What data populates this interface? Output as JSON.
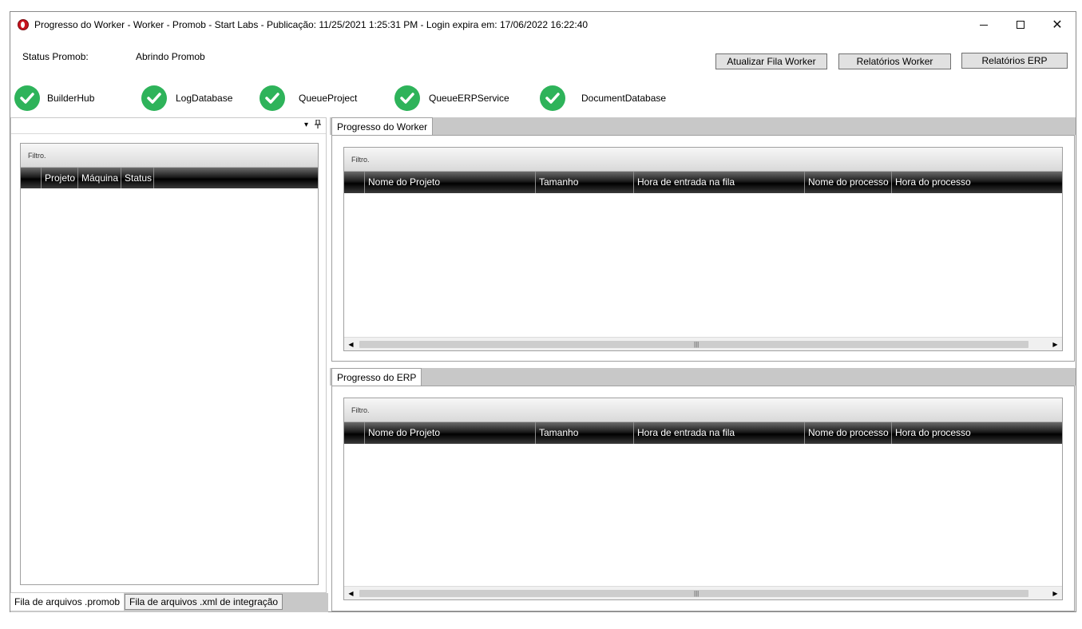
{
  "window": {
    "title": "Progresso do Worker  -  Worker - Promob  -  Start Labs  -  Publicação: 11/25/2021 1:25:31 PM - Login expira em: 17/06/2022 16:22:40",
    "controls": {
      "minimize": "minimize",
      "maximize": "maximize",
      "close": "✕"
    }
  },
  "status": {
    "label": "Status Promob:",
    "value": "Abrindo Promob"
  },
  "toolbar": {
    "update_queue": "Atualizar Fila Worker",
    "worker_reports": "Relatórios Worker",
    "erp_reports": "Relatórios ERP"
  },
  "services": [
    {
      "name": "BuilderHub",
      "status_icon": "check-icon"
    },
    {
      "name": "LogDatabase",
      "status_icon": "check-icon"
    },
    {
      "name": "QueueProject",
      "status_icon": "check-icon"
    },
    {
      "name": "QueueERPService",
      "status_icon": "check-icon"
    },
    {
      "name": "DocumentDatabase",
      "status_icon": "check-icon"
    }
  ],
  "left_panel": {
    "filter": "Filtro.",
    "columns": [
      "Projeto",
      "Máquina",
      "Status"
    ],
    "dropdown_icon": "▾",
    "pin_icon": "📌",
    "tabs": [
      "Fila de arquivos .promob",
      "Fila de arquivos .xml de integração"
    ]
  },
  "worker_panel": {
    "tab": "Progresso do Worker",
    "filter": "Filtro.",
    "columns": [
      "Nome do Projeto",
      "Tamanho",
      "Hora de entrada na fila",
      "Nome do processo",
      "Hora do processo"
    ]
  },
  "erp_panel": {
    "tab": "Progresso do ERP",
    "filter": "Filtro.",
    "columns": [
      "Nome do Projeto",
      "Tamanho",
      "Hora de entrada na fila",
      "Nome do processo",
      "Hora do processo"
    ]
  },
  "colors": {
    "check": "#2eb35a",
    "arrow": "#e01010",
    "header_bg": "#000000"
  }
}
